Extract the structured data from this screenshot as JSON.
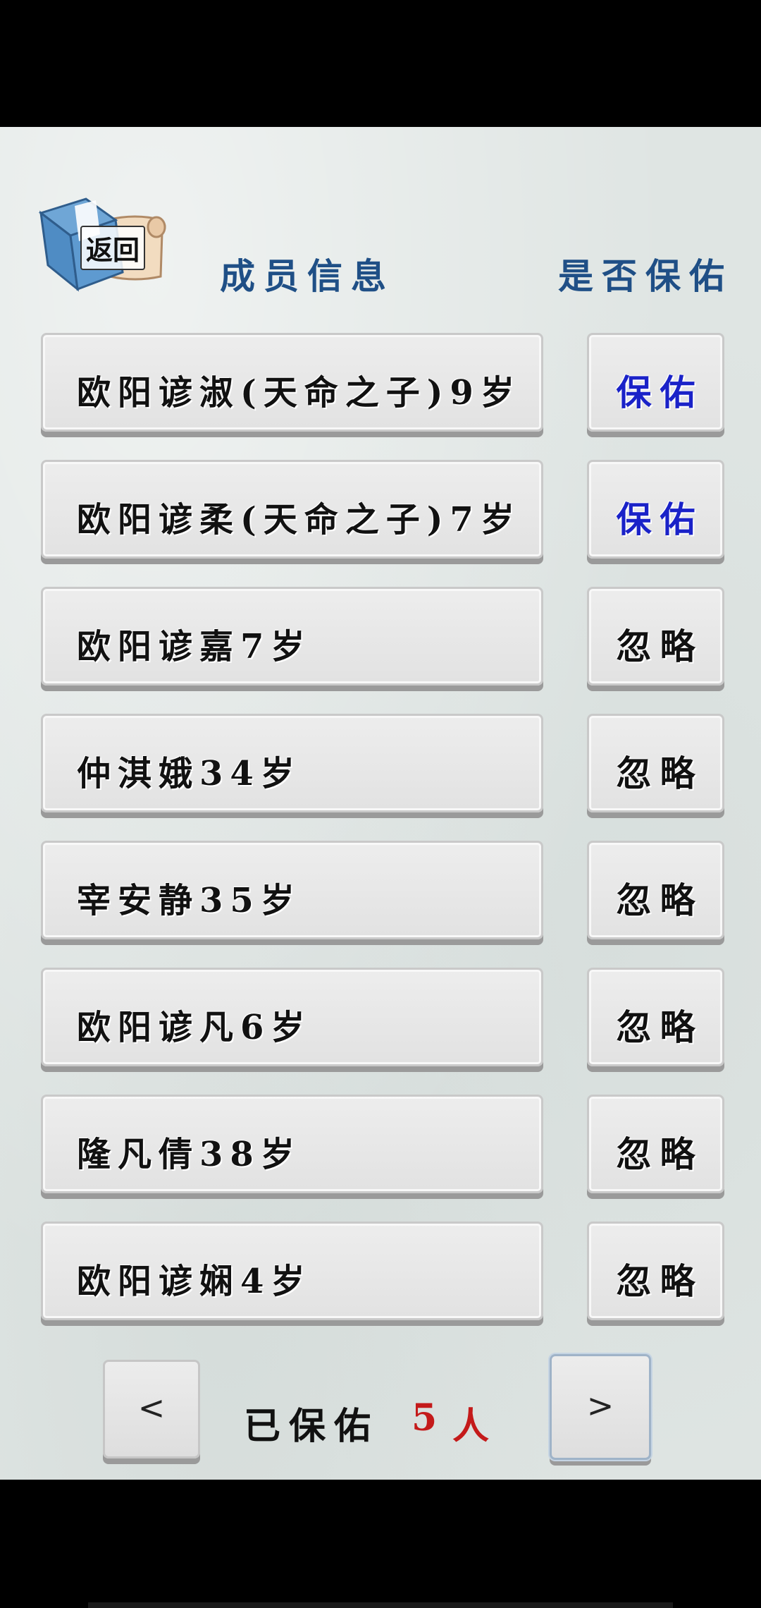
{
  "back": {
    "label": "返回"
  },
  "header": {
    "member_info": "成员信息",
    "protect_question": "是否保佑"
  },
  "members": [
    {
      "name": "欧阳谚淑(天命之子)9岁",
      "status": "保佑",
      "status_color": "#1a22c8"
    },
    {
      "name": "欧阳谚柔(天命之子)7岁",
      "status": "保佑",
      "status_color": "#1a22c8"
    },
    {
      "name": "欧阳谚嘉7岁",
      "status": "忽略",
      "status_color": "#111111"
    },
    {
      "name": "仲淇娥34岁",
      "status": "忽略",
      "status_color": "#111111"
    },
    {
      "name": "宰安静35岁",
      "status": "忽略",
      "status_color": "#111111"
    },
    {
      "name": "欧阳谚凡6岁",
      "status": "忽略",
      "status_color": "#111111"
    },
    {
      "name": "隆凡倩38岁",
      "status": "忽略",
      "status_color": "#111111"
    },
    {
      "name": "欧阳谚娴4岁",
      "status": "忽略",
      "status_color": "#111111"
    }
  ],
  "footer": {
    "prev_label": "<",
    "next_label": ">",
    "protected_label": "已保佑",
    "protected_count": "5",
    "protected_unit": "人"
  }
}
